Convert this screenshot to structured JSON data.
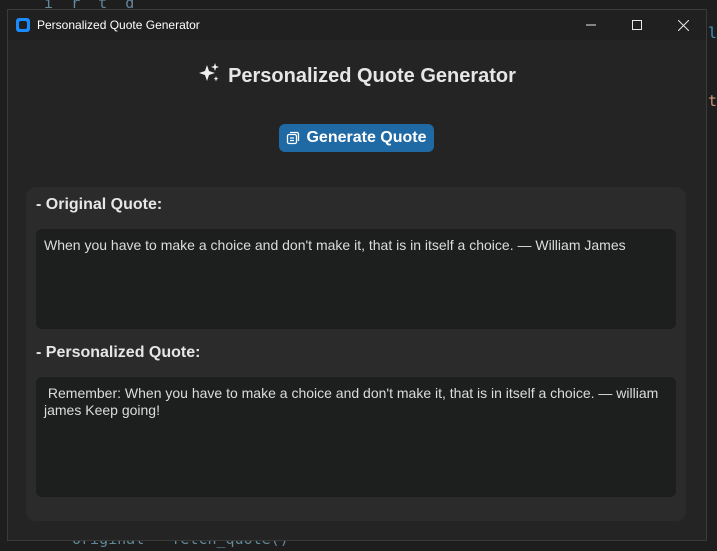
{
  "window": {
    "title": "Personalized Quote Generator"
  },
  "controls": {
    "minimize_icon": "minimize-icon",
    "maximize_icon": "maximize-icon",
    "close_icon": "close-icon"
  },
  "app": {
    "heading": "Personalized Quote Generator",
    "heading_icon": "sparkles-icon",
    "generate_button": "Generate Quote",
    "generate_icon": "copy-icon"
  },
  "original": {
    "label": "- Original Quote:",
    "text": "When you have to make a choice and don't make it, that is in itself a choice. — William James"
  },
  "personalized": {
    "label": "- Personalized Quote:",
    "text": " Remember: When you have to make a choice and don't make it, that is in itself a choice. — william james Keep going!"
  },
  "colors": {
    "accent": "#1f6aa5",
    "window_bg": "#242424",
    "panel_bg": "#2b2b2b",
    "textbox_bg": "#1d1e1e"
  }
}
